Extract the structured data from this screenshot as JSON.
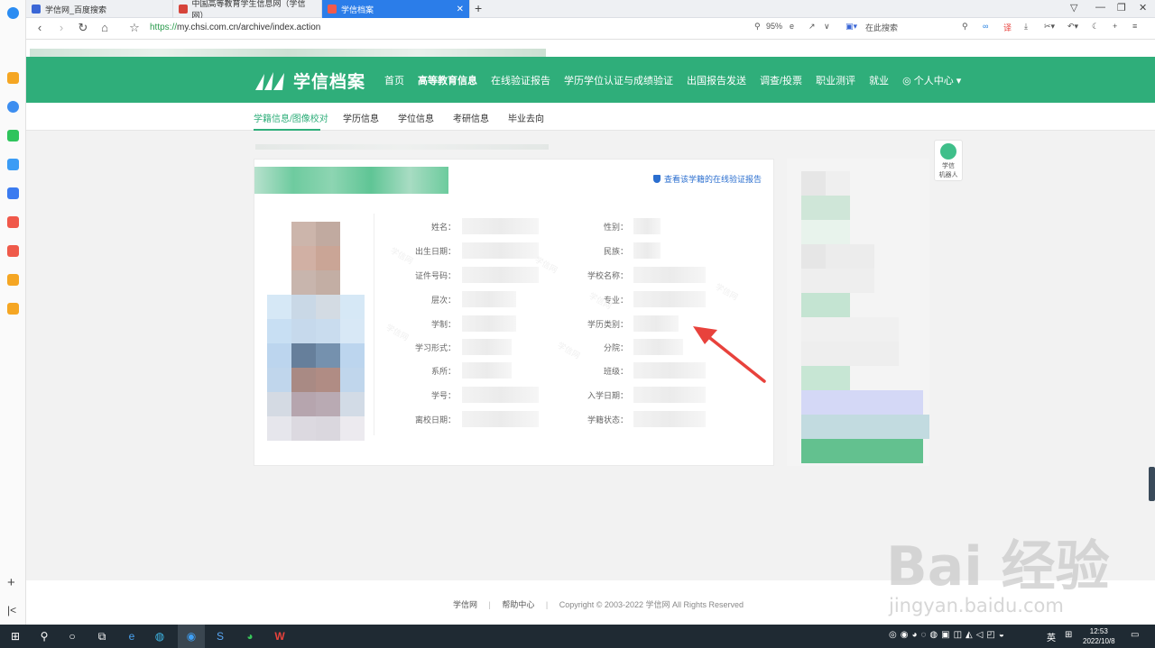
{
  "browser": {
    "tabs": [
      {
        "title": "学信网_百度搜索",
        "active": false
      },
      {
        "title": "中国高等教育学生信息网（学信网）",
        "active": false
      },
      {
        "title": "学信档案",
        "active": true
      }
    ],
    "url_scheme": "https://",
    "url_rest": "my.chsi.com.cn/archive/index.action",
    "zoom": "95%",
    "search_placeholder": "在此搜索"
  },
  "site": {
    "logo_text": "学信档案",
    "nav": [
      {
        "label": "首页"
      },
      {
        "label": "高等教育信息",
        "active": true
      },
      {
        "label": "在线验证报告"
      },
      {
        "label": "学历学位认证与成绩验证"
      },
      {
        "label": "出国报告发送"
      },
      {
        "label": "调查/投票"
      },
      {
        "label": "职业测评"
      },
      {
        "label": "就业"
      },
      {
        "label": "个人中心"
      }
    ],
    "subnav": [
      {
        "label": "学籍信息/图像校对",
        "active": true
      },
      {
        "label": "学历信息"
      },
      {
        "label": "学位信息"
      },
      {
        "label": "考研信息"
      },
      {
        "label": "毕业去向"
      }
    ]
  },
  "card": {
    "verify_link": "查看该学籍的在线验证报告",
    "left_fields": [
      "姓名：",
      "出生日期：",
      "证件号码：",
      "层次：",
      "学制：",
      "学习形式：",
      "系所：",
      "学号：",
      "离校日期："
    ],
    "right_fields": [
      "性别：",
      "民族：",
      "学校名称：",
      "专业：",
      "学历类别：",
      "分院：",
      "班级：",
      "入学日期：",
      "学籍状态："
    ],
    "watermark": "学信网"
  },
  "robot": {
    "label_line1": "学信",
    "label_line2": "机器人"
  },
  "footer": {
    "link1": "学信网",
    "link2": "帮助中心",
    "copyright": "Copyright © 2003-2022 学信网 All Rights Reserved"
  },
  "baidu_watermark": {
    "main": "Bai 经验",
    "sub": "jingyan.baidu.com"
  },
  "taskbar": {
    "time": "12:53",
    "date": "2022/10/8",
    "ime": "英"
  },
  "colors": {
    "brand_green": "#2fae7a",
    "link_blue": "#2a6ecf",
    "arrow_red": "#e8423c"
  }
}
